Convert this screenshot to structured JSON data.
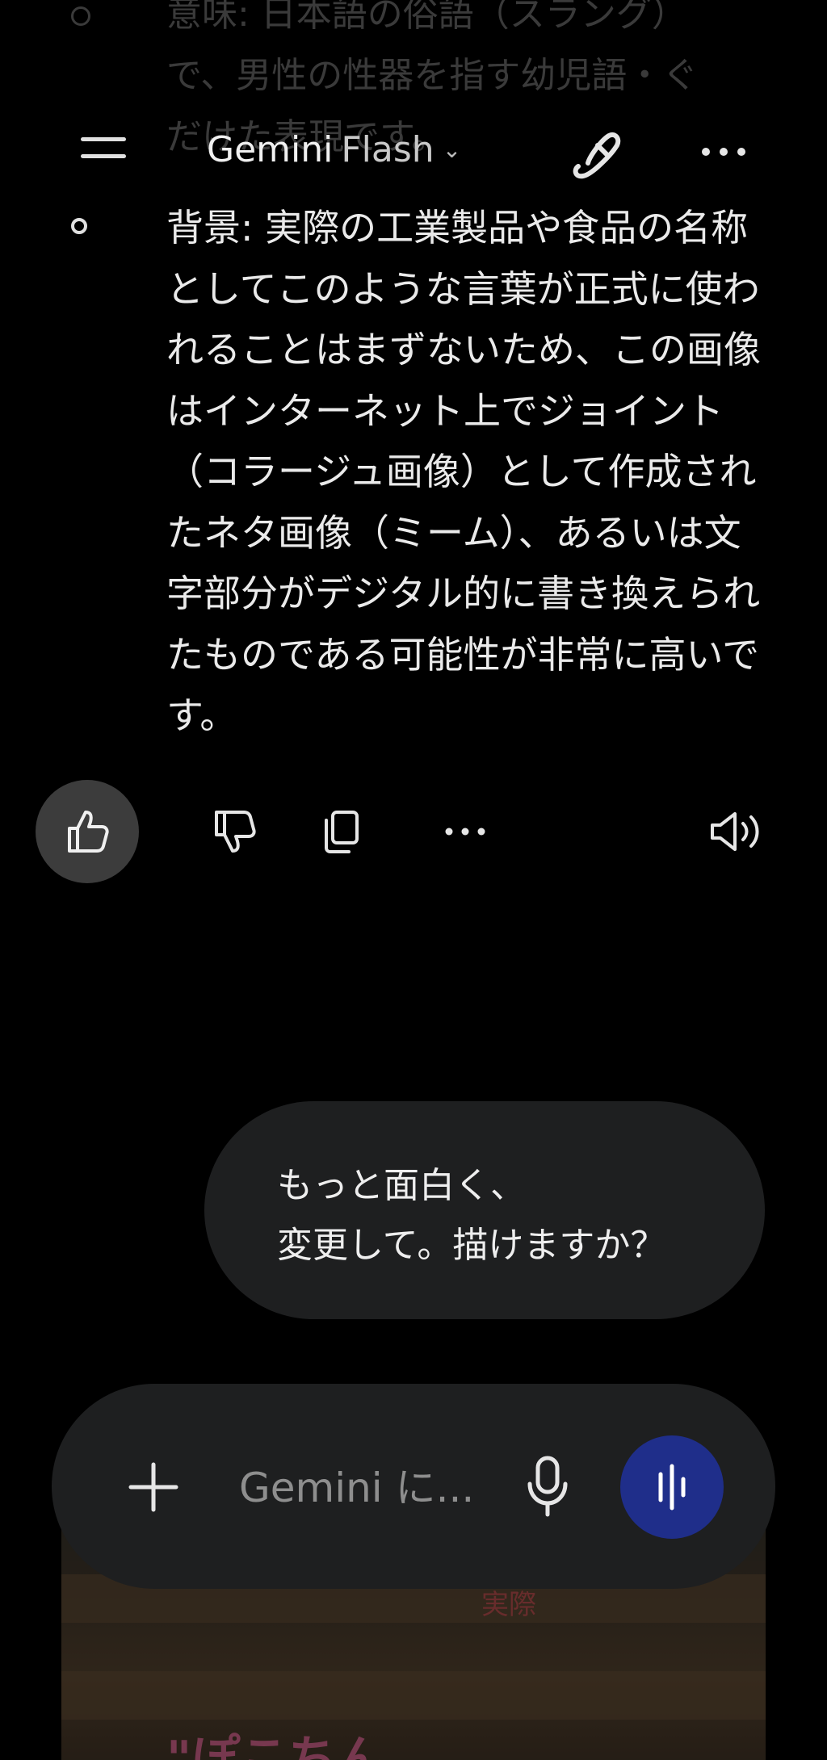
{
  "faded_text": {
    "line1": "意味: 日本語の俗語（スラング）",
    "line2": "で、男性の性器を指す幼児語・ぐ",
    "line3": "だけた表現です。"
  },
  "header": {
    "model_name": "Gemini",
    "model_variant": "Flash",
    "menu_icon": "hamburger-menu-icon",
    "edit_icon": "new-chat-edit-icon",
    "more_icon": "more-horizontal-icon"
  },
  "response": {
    "bullet_text": "背景: 実際の工業製品や食品の名称としてこのような言葉が正式に使われることはまずないため、この画像はインターネット上でジョイント（コラージュ画像）として作成されたネタ画像（ミーム）、あるいは文字部分がデジタル的に書き換えられたものである可能性が非常に高いです。"
  },
  "actions": {
    "like_icon": "thumbs-up-icon",
    "dislike_icon": "thumbs-down-icon",
    "copy_icon": "copy-icon",
    "more_icon": "more-horizontal-icon",
    "speaker_icon": "speaker-icon"
  },
  "user_message": {
    "text": "もっと面白く、\n変更して。描けますか？"
  },
  "background_image": {
    "sign_small": "実際",
    "sign_large": "\"ぽこちん"
  },
  "input": {
    "placeholder": "Gemini に...",
    "plus_icon": "plus-icon",
    "mic_icon": "microphone-icon",
    "voice_icon": "voice-mode-icon",
    "voice_button_color": "#1f2e8a"
  }
}
